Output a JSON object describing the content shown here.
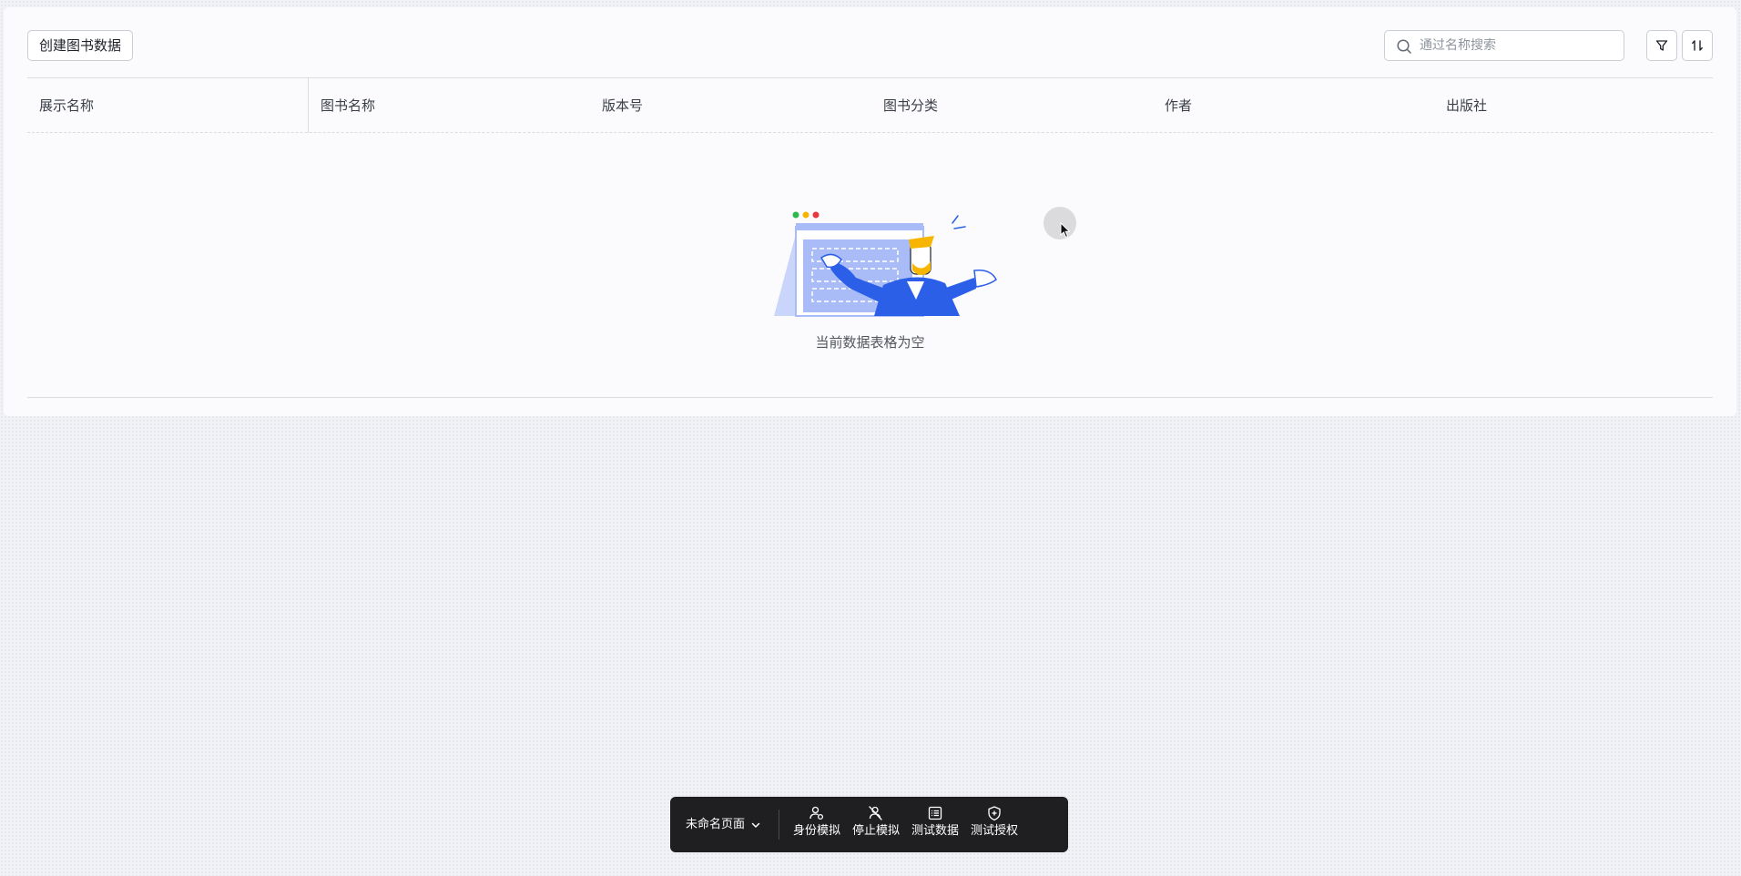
{
  "toolbar": {
    "create_label": "创建图书数据",
    "search_placeholder": "通过名称搜索"
  },
  "table": {
    "columns": [
      "展示名称",
      "图书名称",
      "版本号",
      "图书分类",
      "作者",
      "出版社"
    ],
    "empty_text": "当前数据表格为空"
  },
  "dock": {
    "page_name": "未命名页面",
    "items": [
      {
        "label": "身份模拟",
        "icon": "user-settings-icon"
      },
      {
        "label": "停止模拟",
        "icon": "user-off-icon"
      },
      {
        "label": "测试数据",
        "icon": "list-icon"
      },
      {
        "label": "测试授权",
        "icon": "shield-plus-icon"
      }
    ]
  },
  "colors": {
    "accent": "#2b5fe8",
    "illustration_light": "#a9bcf7",
    "dock_bg": "#1f1f21"
  }
}
